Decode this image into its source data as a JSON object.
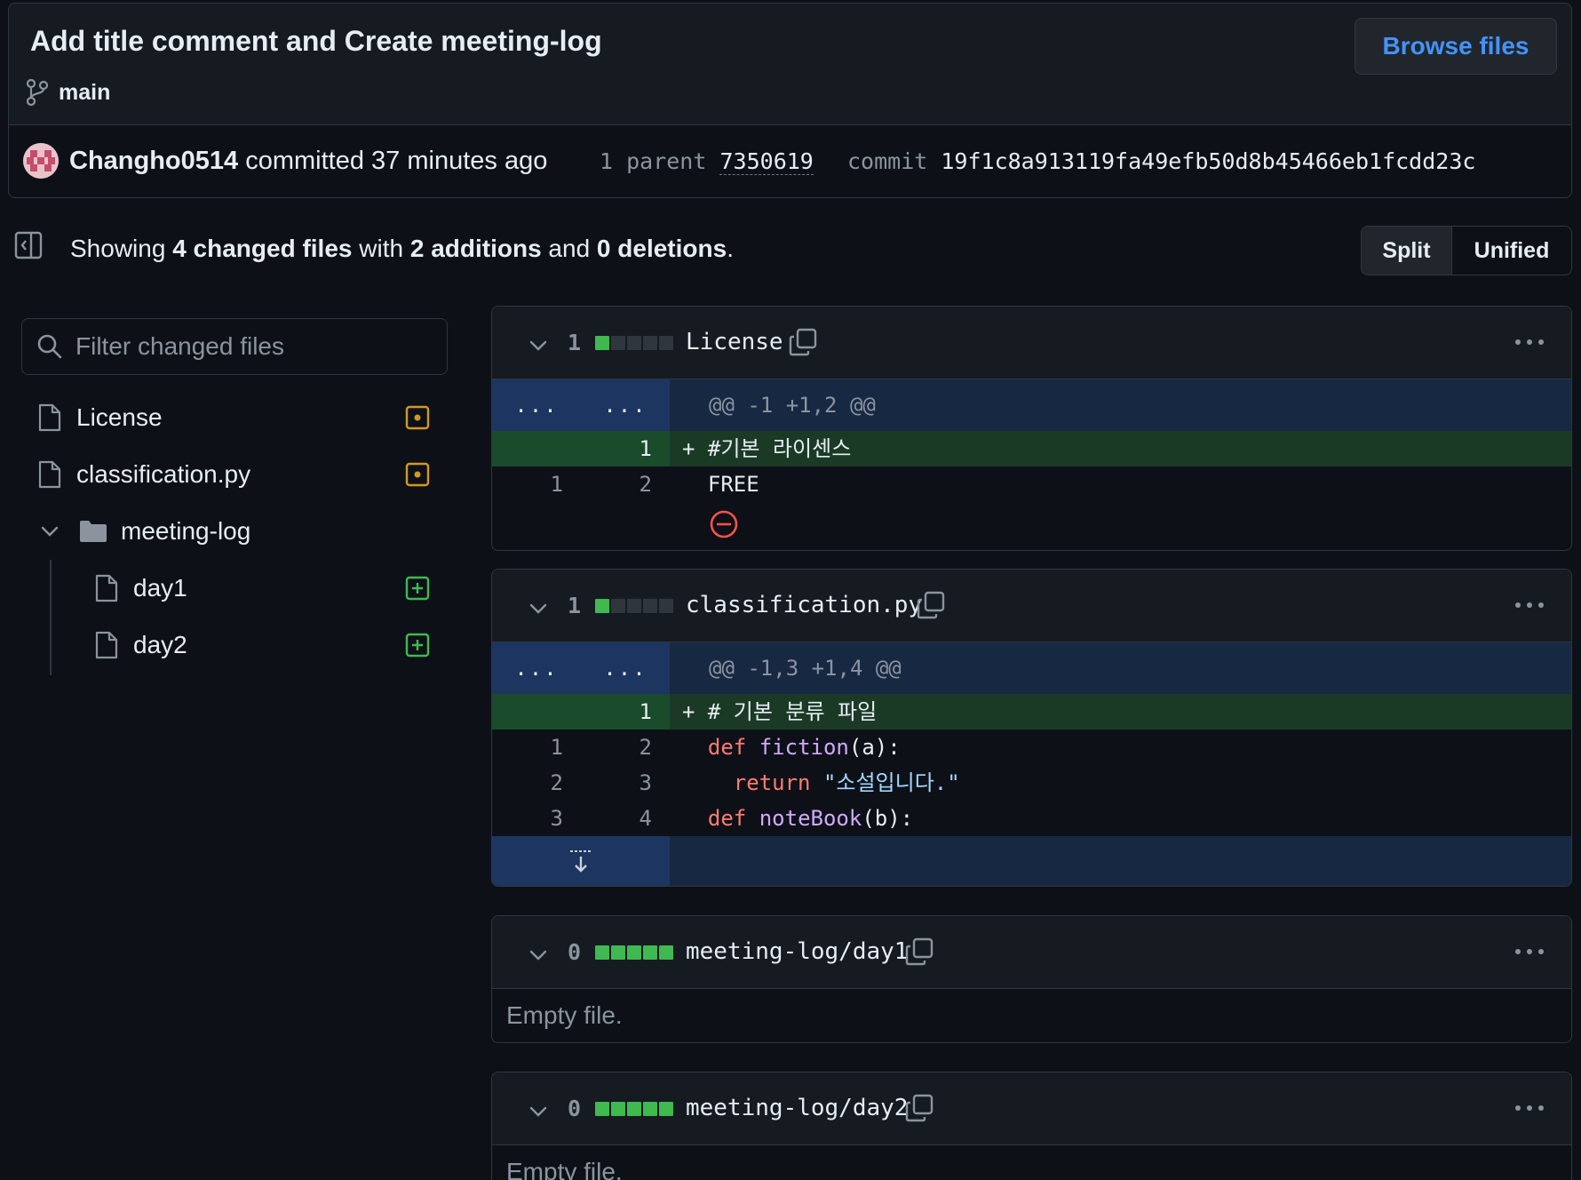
{
  "commit": {
    "title": "Add title comment and Create meeting-log",
    "browse_files_label": "Browse files",
    "branch": "main",
    "author": "Changho0514",
    "committed_text": "committed 37 minutes ago",
    "parent_label": "1 parent",
    "parent_hash": "7350619",
    "commit_label": "commit",
    "commit_sha": "19f1c8a913119fa49efb50d8b45466eb1fcdd23c"
  },
  "summary": {
    "showing": "Showing",
    "changed_files": "4 changed files",
    "with": "with",
    "additions": "2 additions",
    "and": "and",
    "deletions": "0 deletions",
    "period": "."
  },
  "view_toggle": {
    "split": "Split",
    "unified": "Unified"
  },
  "file_tree": {
    "filter_placeholder": "Filter changed files",
    "items": [
      {
        "label": "License",
        "status": "modified"
      },
      {
        "label": "classification.py",
        "status": "modified"
      },
      {
        "label": "meeting-log",
        "type": "folder"
      },
      {
        "label": "day1",
        "status": "added"
      },
      {
        "label": "day2",
        "status": "added"
      }
    ]
  },
  "diffs": [
    {
      "count": "1",
      "file": "License",
      "hunk_left": "...",
      "hunk_right": "...",
      "hunk": "@@ -1 +1,2 @@",
      "added_ln": "1",
      "added_line": "+ #기본 라이센스",
      "ctx_ln1": "1",
      "ctx_ln2": "2",
      "ctx_line": "  FREE"
    },
    {
      "count": "1",
      "file": "classification.py",
      "hunk_left": "...",
      "hunk_right": "...",
      "hunk": "@@ -1,3 +1,4 @@",
      "added_ln": "1",
      "added_line": "+ # 기본 분류 파일",
      "rows": [
        {
          "ln1": "1",
          "ln2": "2",
          "kw": "def",
          "fn": "fiction",
          "rest": "(a):"
        },
        {
          "ln1": "2",
          "ln2": "3",
          "kw": "return",
          "str": "\"소설입니다.\""
        },
        {
          "ln1": "3",
          "ln2": "4",
          "kw": "def",
          "fn": "noteBook",
          "rest": "(b):"
        }
      ]
    },
    {
      "count": "0",
      "file": "meeting-log/day1",
      "empty": "Empty file."
    },
    {
      "count": "0",
      "file": "meeting-log/day2",
      "empty": "Empty file."
    }
  ],
  "colors": {
    "accent": "#4493f8",
    "added": "#3fb950",
    "modified": "#d29922",
    "removed": "#f85149"
  }
}
